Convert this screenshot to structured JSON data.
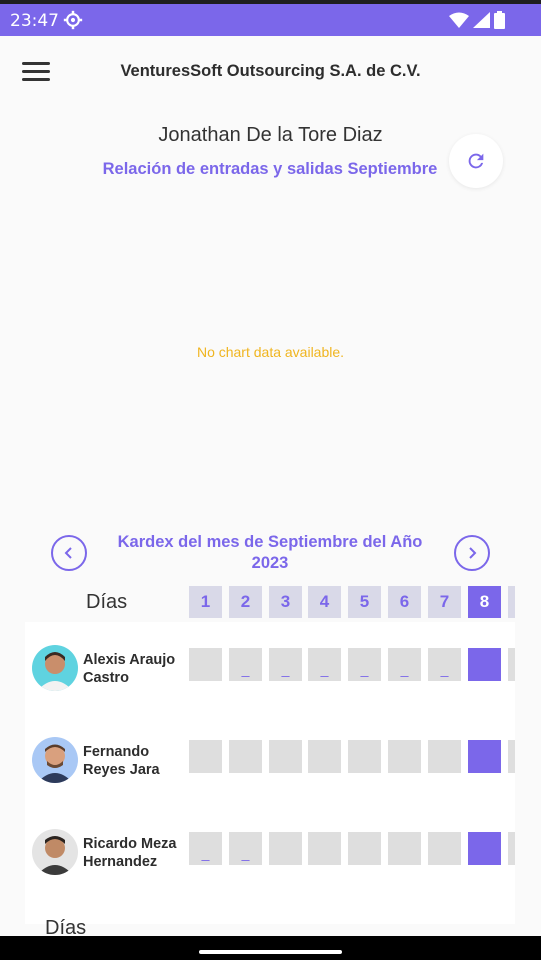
{
  "status_bar": {
    "time": "23:47",
    "settings_icon": "gear-icon",
    "wifi_icon": "wifi-icon",
    "signal_icon": "signal-icon",
    "battery_icon": "battery-icon"
  },
  "app_bar": {
    "title": "VenturesSoft Outsourcing S.A. de C.V.",
    "menu_icon": "menu-icon"
  },
  "header": {
    "person_name": "Jonathan De la Tore Diaz",
    "subtitle": "Relación de entradas y salidas Septiembre",
    "refresh_icon": "refresh-icon"
  },
  "chart": {
    "empty_message": "No chart data available."
  },
  "kardex": {
    "title": "Kardex del mes de Septiembre del Año 2023",
    "prev_icon": "chevron-left-icon",
    "next_icon": "chevron-right-icon",
    "days_label": "Días",
    "days": [
      "1",
      "2",
      "3",
      "4",
      "5",
      "6",
      "7",
      "8"
    ],
    "selected_day": "8",
    "employees": [
      {
        "name": "Alexis Araujo Castro",
        "marks": [
          "",
          "_",
          "_",
          "_",
          "_",
          "_",
          "_",
          ""
        ]
      },
      {
        "name": "Fernando Reyes Jara",
        "marks": [
          "",
          "",
          "",
          "",
          "",
          "",
          "",
          ""
        ]
      },
      {
        "name": "Ricardo Meza Hernandez",
        "marks": [
          "_",
          "_",
          "",
          "",
          "",
          "",
          "",
          ""
        ]
      }
    ],
    "footer_label_peek": "Días"
  },
  "colors": {
    "accent": "#7b67ea",
    "warning": "#f0b520",
    "cell_empty": "#dedede",
    "header_cell": "#d9d9e8"
  }
}
